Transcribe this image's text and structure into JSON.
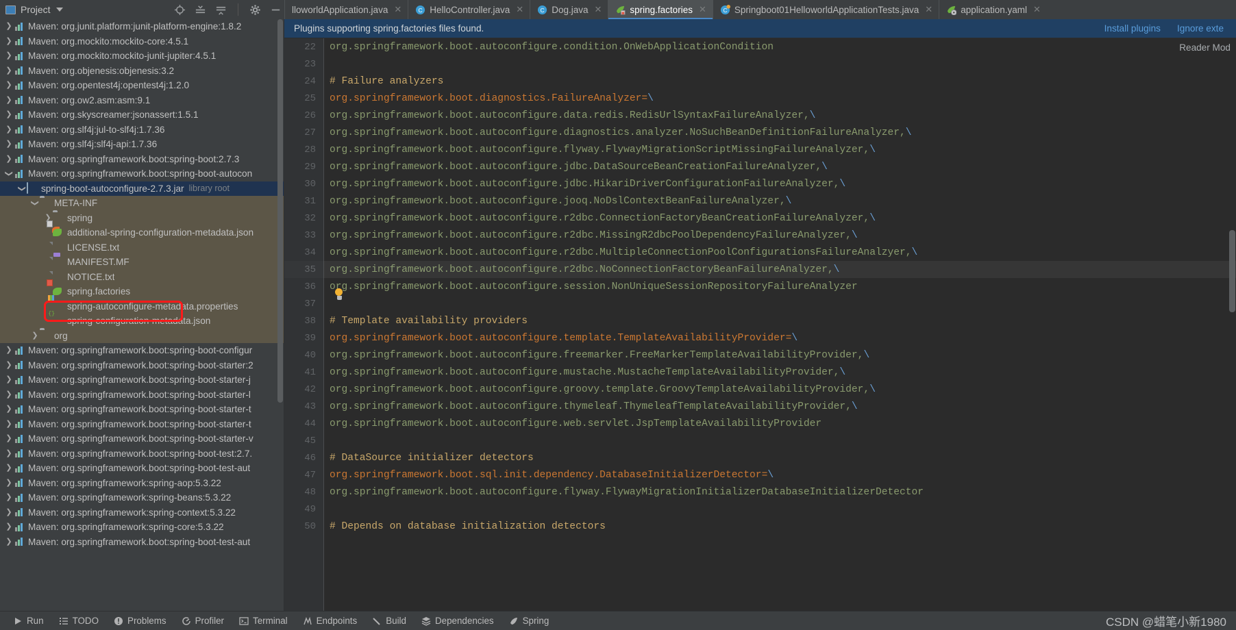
{
  "project_panel": {
    "title": "Project",
    "icon": "project-window-icon",
    "dropdown_icon": "chevron-down-icon",
    "toolbar_icons": [
      "locate-target-icon",
      "expand-all-icon",
      "collapse-all-icon",
      "settings-gear-icon",
      "hide-minimize-icon"
    ]
  },
  "tabs": [
    {
      "label": "lloworldApplication.java",
      "icon": "java-class-icon",
      "active": false,
      "truncated": true
    },
    {
      "label": "HelloController.java",
      "icon": "java-class-icon",
      "active": false
    },
    {
      "label": "Dog.java",
      "icon": "java-class-icon",
      "active": false
    },
    {
      "label": "spring.factories",
      "icon": "spring-leaf-icon",
      "active": true
    },
    {
      "label": "Springboot01HelloworldApplicationTests.java",
      "icon": "java-test-class-icon",
      "active": false
    },
    {
      "label": "application.yaml",
      "icon": "spring-yaml-icon",
      "active": false
    }
  ],
  "notification": {
    "message": "Plugins supporting spring.factories files found.",
    "install_label": "Install plugins",
    "ignore_label": "Ignore exte"
  },
  "editor": {
    "reader_mode_label": "Reader Mod",
    "first_line_number": 22,
    "lines": [
      {
        "n": 22,
        "type": "value",
        "text": "org.springframework.boot.autoconfigure.condition.OnWebApplicationCondition"
      },
      {
        "n": 23,
        "type": "blank",
        "text": ""
      },
      {
        "n": 24,
        "type": "comment",
        "text": "# Failure analyzers"
      },
      {
        "n": 25,
        "type": "key",
        "text": "org.springframework.boot.diagnostics.FailureAnalyzer=\\"
      },
      {
        "n": 26,
        "type": "value",
        "text": "org.springframework.boot.autoconfigure.data.redis.RedisUrlSyntaxFailureAnalyzer,\\"
      },
      {
        "n": 27,
        "type": "value",
        "text": "org.springframework.boot.autoconfigure.diagnostics.analyzer.NoSuchBeanDefinitionFailureAnalyzer,\\"
      },
      {
        "n": 28,
        "type": "value",
        "text": "org.springframework.boot.autoconfigure.flyway.FlywayMigrationScriptMissingFailureAnalyzer,\\"
      },
      {
        "n": 29,
        "type": "value",
        "text": "org.springframework.boot.autoconfigure.jdbc.DataSourceBeanCreationFailureAnalyzer,\\"
      },
      {
        "n": 30,
        "type": "value",
        "text": "org.springframework.boot.autoconfigure.jdbc.HikariDriverConfigurationFailureAnalyzer,\\"
      },
      {
        "n": 31,
        "type": "value",
        "text": "org.springframework.boot.autoconfigure.jooq.NoDslContextBeanFailureAnalyzer,\\"
      },
      {
        "n": 32,
        "type": "value",
        "text": "org.springframework.boot.autoconfigure.r2dbc.ConnectionFactoryBeanCreationFailureAnalyzer,\\"
      },
      {
        "n": 33,
        "type": "value",
        "text": "org.springframework.boot.autoconfigure.r2dbc.MissingR2dbcPoolDependencyFailureAnalyzer,\\"
      },
      {
        "n": 34,
        "type": "value",
        "text": "org.springframework.boot.autoconfigure.r2dbc.MultipleConnectionPoolConfigurationsFailureAnalzyer,\\"
      },
      {
        "n": 35,
        "type": "value",
        "text": "org.springframework.boot.autoconfigure.r2dbc.NoConnectionFactoryBeanFailureAnalyzer,\\",
        "highlighted": true
      },
      {
        "n": 36,
        "type": "value",
        "text": "org.springframework.boot.autoconfigure.session.NonUniqueSessionRepositoryFailureAnalyzer"
      },
      {
        "n": 37,
        "type": "blank",
        "text": ""
      },
      {
        "n": 38,
        "type": "comment",
        "text": "# Template availability providers"
      },
      {
        "n": 39,
        "type": "key",
        "text": "org.springframework.boot.autoconfigure.template.TemplateAvailabilityProvider=\\"
      },
      {
        "n": 40,
        "type": "value",
        "text": "org.springframework.boot.autoconfigure.freemarker.FreeMarkerTemplateAvailabilityProvider,\\"
      },
      {
        "n": 41,
        "type": "value",
        "text": "org.springframework.boot.autoconfigure.mustache.MustacheTemplateAvailabilityProvider,\\"
      },
      {
        "n": 42,
        "type": "value",
        "text": "org.springframework.boot.autoconfigure.groovy.template.GroovyTemplateAvailabilityProvider,\\"
      },
      {
        "n": 43,
        "type": "value",
        "text": "org.springframework.boot.autoconfigure.thymeleaf.ThymeleafTemplateAvailabilityProvider,\\"
      },
      {
        "n": 44,
        "type": "value",
        "text": "org.springframework.boot.autoconfigure.web.servlet.JspTemplateAvailabilityProvider"
      },
      {
        "n": 45,
        "type": "blank",
        "text": ""
      },
      {
        "n": 46,
        "type": "comment",
        "text": "# DataSource initializer detectors"
      },
      {
        "n": 47,
        "type": "key",
        "text": "org.springframework.boot.sql.init.dependency.DatabaseInitializerDetector=\\"
      },
      {
        "n": 48,
        "type": "value",
        "text": "org.springframework.boot.autoconfigure.flyway.FlywayMigrationInitializerDatabaseInitializerDetector"
      },
      {
        "n": 49,
        "type": "blank",
        "text": ""
      },
      {
        "n": 50,
        "type": "comment",
        "text": "# Depends on database initialization detectors"
      }
    ],
    "colors": {
      "key": "#cc7832",
      "value": "#8a9b6e",
      "comment": "#c9a86a",
      "escape": "#6a9fd4",
      "background": "#2b2b2b"
    }
  },
  "tree": [
    {
      "label": "Maven: org.junit.platform:junit-platform-engine:1.8.2",
      "icon": "maven-icon",
      "indent": 0,
      "arrow": "collapsed"
    },
    {
      "label": "Maven: org.mockito:mockito-core:4.5.1",
      "icon": "maven-icon",
      "indent": 0,
      "arrow": "collapsed"
    },
    {
      "label": "Maven: org.mockito:mockito-junit-jupiter:4.5.1",
      "icon": "maven-icon",
      "indent": 0,
      "arrow": "collapsed"
    },
    {
      "label": "Maven: org.objenesis:objenesis:3.2",
      "icon": "maven-icon",
      "indent": 0,
      "arrow": "collapsed"
    },
    {
      "label": "Maven: org.opentest4j:opentest4j:1.2.0",
      "icon": "maven-icon",
      "indent": 0,
      "arrow": "collapsed"
    },
    {
      "label": "Maven: org.ow2.asm:asm:9.1",
      "icon": "maven-icon",
      "indent": 0,
      "arrow": "collapsed"
    },
    {
      "label": "Maven: org.skyscreamer:jsonassert:1.5.1",
      "icon": "maven-icon",
      "indent": 0,
      "arrow": "collapsed"
    },
    {
      "label": "Maven: org.slf4j:jul-to-slf4j:1.7.36",
      "icon": "maven-icon",
      "indent": 0,
      "arrow": "collapsed"
    },
    {
      "label": "Maven: org.slf4j:slf4j-api:1.7.36",
      "icon": "maven-icon",
      "indent": 0,
      "arrow": "collapsed"
    },
    {
      "label": "Maven: org.springframework.boot:spring-boot:2.7.3",
      "icon": "maven-icon",
      "indent": 0,
      "arrow": "collapsed"
    },
    {
      "label": "Maven: org.springframework.boot:spring-boot-autocon",
      "icon": "maven-icon",
      "indent": 0,
      "arrow": "expanded"
    },
    {
      "label": "spring-boot-autoconfigure-2.7.3.jar",
      "sublabel": "library root",
      "icon": "jar-icon",
      "indent": 1,
      "arrow": "expanded",
      "selected": true
    },
    {
      "label": "META-INF",
      "icon": "folder-icon",
      "indent": 2,
      "arrow": "expanded",
      "injar": true
    },
    {
      "label": "spring",
      "icon": "folder-icon",
      "indent": 3,
      "arrow": "collapsed",
      "injar": true
    },
    {
      "label": "additional-spring-configuration-metadata.json",
      "icon": "spring-json-arrow-icon",
      "indent": 3,
      "arrow": "none",
      "injar": true
    },
    {
      "label": "LICENSE.txt",
      "icon": "text-file-icon",
      "indent": 3,
      "arrow": "none",
      "injar": true
    },
    {
      "label": "MANIFEST.MF",
      "icon": "manifest-file-icon",
      "indent": 3,
      "arrow": "none",
      "injar": true
    },
    {
      "label": "NOTICE.txt",
      "icon": "text-file-icon",
      "indent": 3,
      "arrow": "none",
      "injar": true
    },
    {
      "label": "spring.factories",
      "icon": "spring-factories-icon",
      "indent": 3,
      "arrow": "none",
      "injar": true,
      "annotated": true
    },
    {
      "label": "spring-autoconfigure-metadata.properties",
      "icon": "properties-file-icon",
      "indent": 3,
      "arrow": "none",
      "injar": true
    },
    {
      "label": "spring-configuration-metadata.json",
      "icon": "spring-json-icon",
      "indent": 3,
      "arrow": "none",
      "injar": true
    },
    {
      "label": "org",
      "icon": "folder-icon",
      "indent": 2,
      "arrow": "collapsed",
      "injar": true
    },
    {
      "label": "Maven: org.springframework.boot:spring-boot-configur",
      "icon": "maven-icon",
      "indent": 0,
      "arrow": "collapsed"
    },
    {
      "label": "Maven: org.springframework.boot:spring-boot-starter:2",
      "icon": "maven-icon",
      "indent": 0,
      "arrow": "collapsed"
    },
    {
      "label": "Maven: org.springframework.boot:spring-boot-starter-j",
      "icon": "maven-icon",
      "indent": 0,
      "arrow": "collapsed"
    },
    {
      "label": "Maven: org.springframework.boot:spring-boot-starter-l",
      "icon": "maven-icon",
      "indent": 0,
      "arrow": "collapsed"
    },
    {
      "label": "Maven: org.springframework.boot:spring-boot-starter-t",
      "icon": "maven-icon",
      "indent": 0,
      "arrow": "collapsed"
    },
    {
      "label": "Maven: org.springframework.boot:spring-boot-starter-t",
      "icon": "maven-icon",
      "indent": 0,
      "arrow": "collapsed"
    },
    {
      "label": "Maven: org.springframework.boot:spring-boot-starter-v",
      "icon": "maven-icon",
      "indent": 0,
      "arrow": "collapsed"
    },
    {
      "label": "Maven: org.springframework.boot:spring-boot-test:2.7.",
      "icon": "maven-icon",
      "indent": 0,
      "arrow": "collapsed"
    },
    {
      "label": "Maven: org.springframework.boot:spring-boot-test-aut",
      "icon": "maven-icon",
      "indent": 0,
      "arrow": "collapsed"
    },
    {
      "label": "Maven: org.springframework:spring-aop:5.3.22",
      "icon": "maven-icon",
      "indent": 0,
      "arrow": "collapsed"
    },
    {
      "label": "Maven: org.springframework:spring-beans:5.3.22",
      "icon": "maven-icon",
      "indent": 0,
      "arrow": "collapsed"
    },
    {
      "label": "Maven: org.springframework:spring-context:5.3.22",
      "icon": "maven-icon",
      "indent": 0,
      "arrow": "collapsed"
    },
    {
      "label": "Maven: org.springframework:spring-core:5.3.22",
      "icon": "maven-icon",
      "indent": 0,
      "arrow": "collapsed"
    },
    {
      "label": "Maven: org.springframework.boot:spring-boot-test-aut",
      "icon": "maven-icon",
      "indent": 0,
      "arrow": "collapsed"
    }
  ],
  "statusbar": {
    "items": [
      {
        "label": "Run",
        "icon": "play-run-icon"
      },
      {
        "label": "TODO",
        "icon": "todo-list-icon"
      },
      {
        "label": "Problems",
        "icon": "problems-warning-icon"
      },
      {
        "label": "Profiler",
        "icon": "profiler-icon"
      },
      {
        "label": "Terminal",
        "icon": "terminal-icon"
      },
      {
        "label": "Endpoints",
        "icon": "endpoints-icon"
      },
      {
        "label": "Build",
        "icon": "build-hammer-icon"
      },
      {
        "label": "Dependencies",
        "icon": "dependencies-layers-icon"
      },
      {
        "label": "Spring",
        "icon": "spring-leaf-icon"
      }
    ],
    "watermark": "CSDN @蜡笔小新1980"
  },
  "accent_colors": {
    "tab_active_underline": "#4a88c7",
    "notification_bg": "#204063",
    "link": "#5a9ddb",
    "tree_selection": "#1f3350",
    "jar_content_bg": "#5c5647",
    "annotation_red": "#ff1a1a"
  }
}
